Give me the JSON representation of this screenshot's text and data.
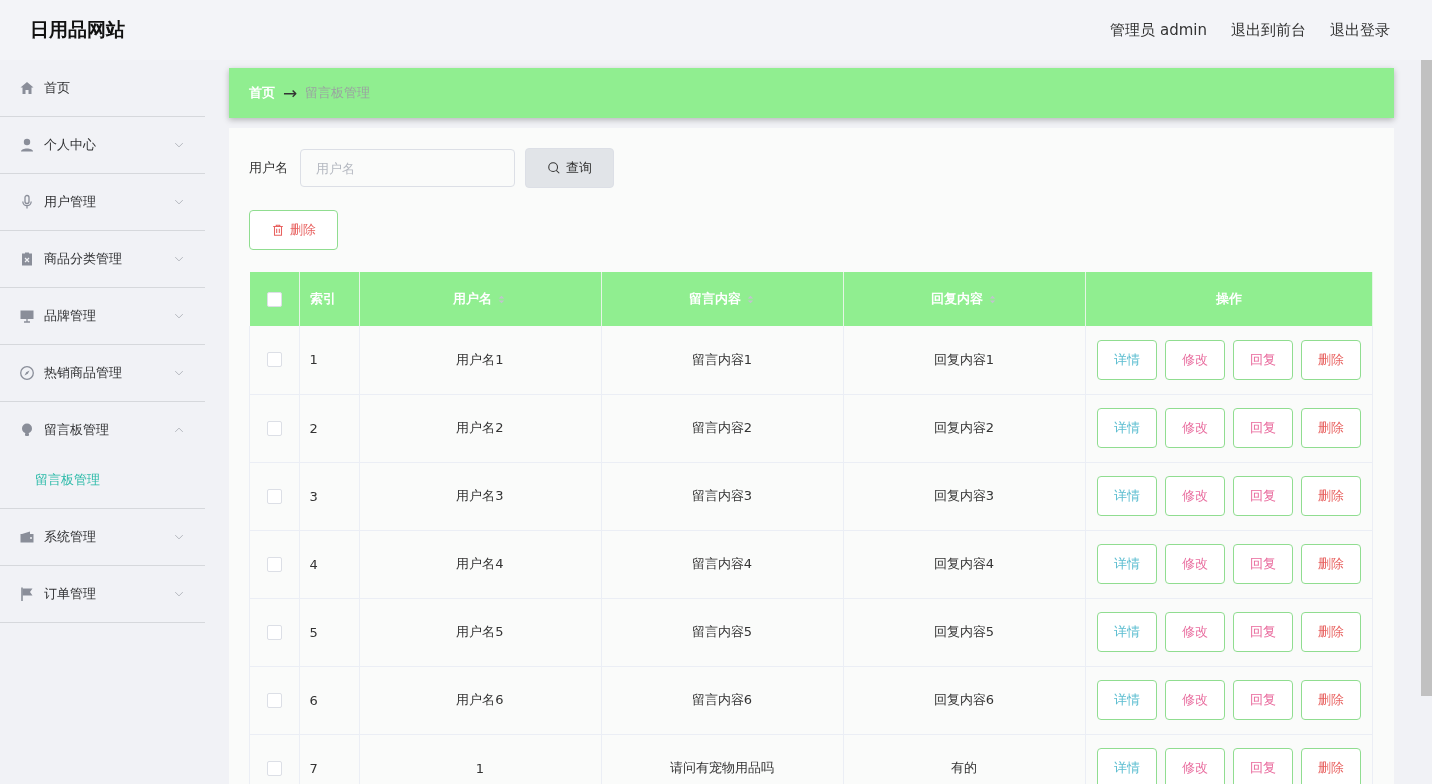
{
  "header": {
    "title": "日用品网站",
    "links": [
      "管理员 admin",
      "退出到前台",
      "退出登录"
    ]
  },
  "sidebar": {
    "items": [
      {
        "label": "首页"
      },
      {
        "label": "个人中心",
        "expanded": false
      },
      {
        "label": "用户管理",
        "expanded": false
      },
      {
        "label": "商品分类管理",
        "expanded": false
      },
      {
        "label": "品牌管理",
        "expanded": false
      },
      {
        "label": "热销商品管理",
        "expanded": false
      },
      {
        "label": "留言板管理",
        "expanded": true,
        "children": [
          {
            "label": "留言板管理",
            "selected": true
          }
        ]
      },
      {
        "label": "系统管理",
        "expanded": false
      },
      {
        "label": "订单管理",
        "expanded": false
      }
    ]
  },
  "breadcrumb": [
    "首页",
    "→",
    "留言板管理"
  ],
  "search": {
    "label": "用户名",
    "placeholder": "用户名",
    "button": "查询"
  },
  "delete_button": "删除",
  "table": {
    "columns": [
      {
        "label": "索引",
        "sortable": false
      },
      {
        "label": "用户名",
        "sortable": true
      },
      {
        "label": "留言内容",
        "sortable": true
      },
      {
        "label": "回复内容",
        "sortable": true
      },
      {
        "label": "操作",
        "sortable": false
      }
    ],
    "header_checked": false,
    "rows": [
      {
        "checked": false,
        "cells": [
          "1",
          "用户名1",
          "留言内容1",
          "回复内容1"
        ],
        "actions": [
          {
            "kind": "detail",
            "label": "详情"
          },
          {
            "kind": "edit",
            "label": "修改"
          },
          {
            "kind": "reply",
            "label": "回复"
          },
          {
            "kind": "delete",
            "label": "删除"
          }
        ]
      },
      {
        "checked": false,
        "cells": [
          "2",
          "用户名2",
          "留言内容2",
          "回复内容2"
        ],
        "actions": [
          {
            "kind": "detail",
            "label": "详情"
          },
          {
            "kind": "edit",
            "label": "修改"
          },
          {
            "kind": "reply",
            "label": "回复"
          },
          {
            "kind": "delete",
            "label": "删除"
          }
        ]
      },
      {
        "checked": false,
        "cells": [
          "3",
          "用户名3",
          "留言内容3",
          "回复内容3"
        ],
        "actions": [
          {
            "kind": "detail",
            "label": "详情"
          },
          {
            "kind": "edit",
            "label": "修改"
          },
          {
            "kind": "reply",
            "label": "回复"
          },
          {
            "kind": "delete",
            "label": "删除"
          }
        ]
      },
      {
        "checked": false,
        "cells": [
          "4",
          "用户名4",
          "留言内容4",
          "回复内容4"
        ],
        "actions": [
          {
            "kind": "detail",
            "label": "详情"
          },
          {
            "kind": "edit",
            "label": "修改"
          },
          {
            "kind": "reply",
            "label": "回复"
          },
          {
            "kind": "delete",
            "label": "删除"
          }
        ]
      },
      {
        "checked": false,
        "cells": [
          "5",
          "用户名5",
          "留言内容5",
          "回复内容5"
        ],
        "actions": [
          {
            "kind": "detail",
            "label": "详情"
          },
          {
            "kind": "edit",
            "label": "修改"
          },
          {
            "kind": "reply",
            "label": "回复"
          },
          {
            "kind": "delete",
            "label": "删除"
          }
        ]
      },
      {
        "checked": false,
        "cells": [
          "6",
          "用户名6",
          "留言内容6",
          "回复内容6"
        ],
        "actions": [
          {
            "kind": "detail",
            "label": "详情"
          },
          {
            "kind": "edit",
            "label": "修改"
          },
          {
            "kind": "reply",
            "label": "回复"
          },
          {
            "kind": "delete",
            "label": "删除"
          }
        ]
      },
      {
        "checked": false,
        "cells": [
          "7",
          "1",
          "请问有宠物用品吗",
          "有的"
        ],
        "actions": [
          {
            "kind": "detail",
            "label": "详情"
          },
          {
            "kind": "edit",
            "label": "修改"
          },
          {
            "kind": "reply",
            "label": "回复"
          },
          {
            "kind": "delete",
            "label": "删除"
          }
        ]
      }
    ]
  }
}
